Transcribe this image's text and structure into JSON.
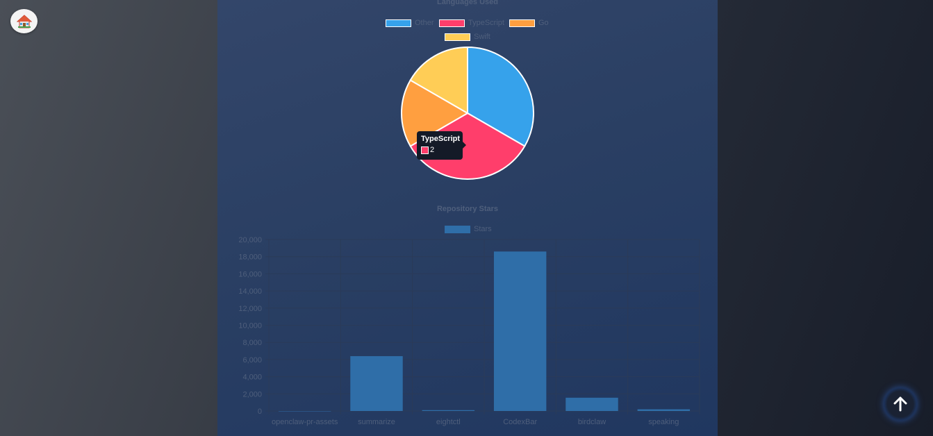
{
  "home_button": {
    "icon": "house-icon"
  },
  "scroll_top_button": {
    "icon": "arrow-up-icon"
  },
  "colors": {
    "other": "#36a2eb",
    "typescript": "#ff3e6b",
    "go": "#ff9f40",
    "swift": "#ffcd56",
    "stars": "#2f6ea8"
  },
  "pie_tooltip": {
    "title": "TypeScript",
    "value": "2"
  },
  "chart_data": [
    {
      "type": "pie",
      "title": "Languages Used",
      "legend_position": "top",
      "labels": [
        "Other",
        "TypeScript",
        "Go",
        "Swift"
      ],
      "values": [
        2,
        2,
        1,
        1
      ],
      "colors": [
        "#36a2eb",
        "#ff3e6b",
        "#ff9f40",
        "#ffcd56"
      ]
    },
    {
      "type": "bar",
      "title": "Repository Stars",
      "legend_position": "top",
      "series": [
        {
          "name": "Stars",
          "values": [
            0,
            6400,
            100,
            18600,
            1550,
            200
          ]
        }
      ],
      "categories": [
        "openclaw-pr-assets",
        "summarize",
        "eightctl",
        "CodexBar",
        "birdclaw",
        "speaking"
      ],
      "yticks": [
        "0",
        "2,000",
        "4,000",
        "6,000",
        "8,000",
        "10,000",
        "12,000",
        "14,000",
        "16,000",
        "18,000",
        "20,000"
      ],
      "ylim": [
        0,
        20000
      ],
      "grid": true
    }
  ]
}
